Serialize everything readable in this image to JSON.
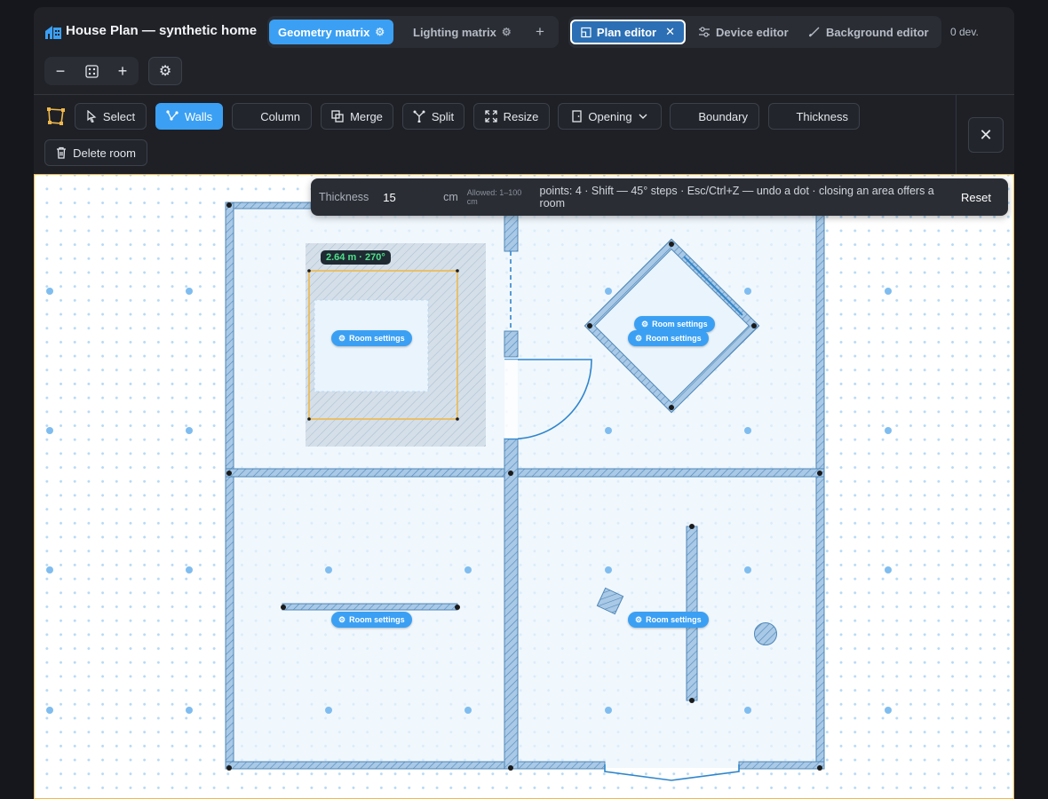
{
  "app": {
    "title": "House Plan — synthetic home",
    "device_count": "0 dev."
  },
  "tabs_left": [
    {
      "label": "Geometry matrix",
      "icon": "gear-icon"
    },
    {
      "label": "Lighting matrix",
      "icon": "gear-icon"
    }
  ],
  "tabs_right": [
    {
      "label": "Plan editor",
      "icon": "plan-icon"
    },
    {
      "label": "Device editor",
      "icon": "sliders-icon"
    },
    {
      "label": "Background editor",
      "icon": "brush-icon"
    }
  ],
  "zoom": {
    "minus": "−",
    "plus": "+"
  },
  "toolbar": {
    "select": "Select",
    "walls": "Walls",
    "column": "Column",
    "merge": "Merge",
    "split": "Split",
    "resize": "Resize",
    "opening": "Opening",
    "boundary": "Boundary",
    "thickness": "Thickness",
    "delete_room": "Delete room"
  },
  "hint": {
    "thickness_label": "Thickness",
    "thickness_value": "15",
    "unit": "cm",
    "allowed": "Allowed: 1–100 cm",
    "info": "points: 4 · Shift — 45° steps · Esc/Ctrl+Z — undo a dot · closing an area offers a room",
    "reset": "Reset"
  },
  "measure": "2.64 m · 270°",
  "room_settings_label": "Room settings",
  "colors": {
    "accent": "#3ba0f3",
    "selection": "#f0b84a",
    "wall_fill": "#a9c9e6",
    "measure_text": "#4ee08a"
  }
}
